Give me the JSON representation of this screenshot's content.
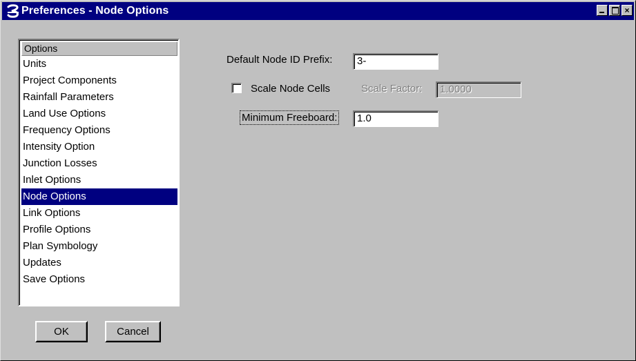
{
  "window": {
    "title": "Preferences - Node Options",
    "controls": {
      "minimize": "_",
      "close": "×"
    }
  },
  "options_list": {
    "header": "Options",
    "items": [
      "Units",
      "Project Components",
      "Rainfall Parameters",
      "Land Use Options",
      "Frequency Options",
      "Intensity Option",
      "Junction Losses",
      "Inlet Options",
      "Node Options",
      "Link Options",
      "Profile Options",
      "Plan Symbology",
      "Updates",
      "Save Options"
    ],
    "selected": "Node Options"
  },
  "buttons": {
    "ok": "OK",
    "cancel": "Cancel"
  },
  "form": {
    "prefix_label": "Default Node ID Prefix:",
    "prefix_value": "3-",
    "scale_label": "Scale Node Cells",
    "scale_checked": false,
    "scale_factor_label": "Scale Factor:",
    "scale_factor_value": "1.0000",
    "freeboard_label": "Minimum Freeboard:",
    "freeboard_value": "1.0"
  },
  "colors": {
    "titlebar": "#000080",
    "selection": "#000080",
    "face": "#c0c0c0"
  }
}
